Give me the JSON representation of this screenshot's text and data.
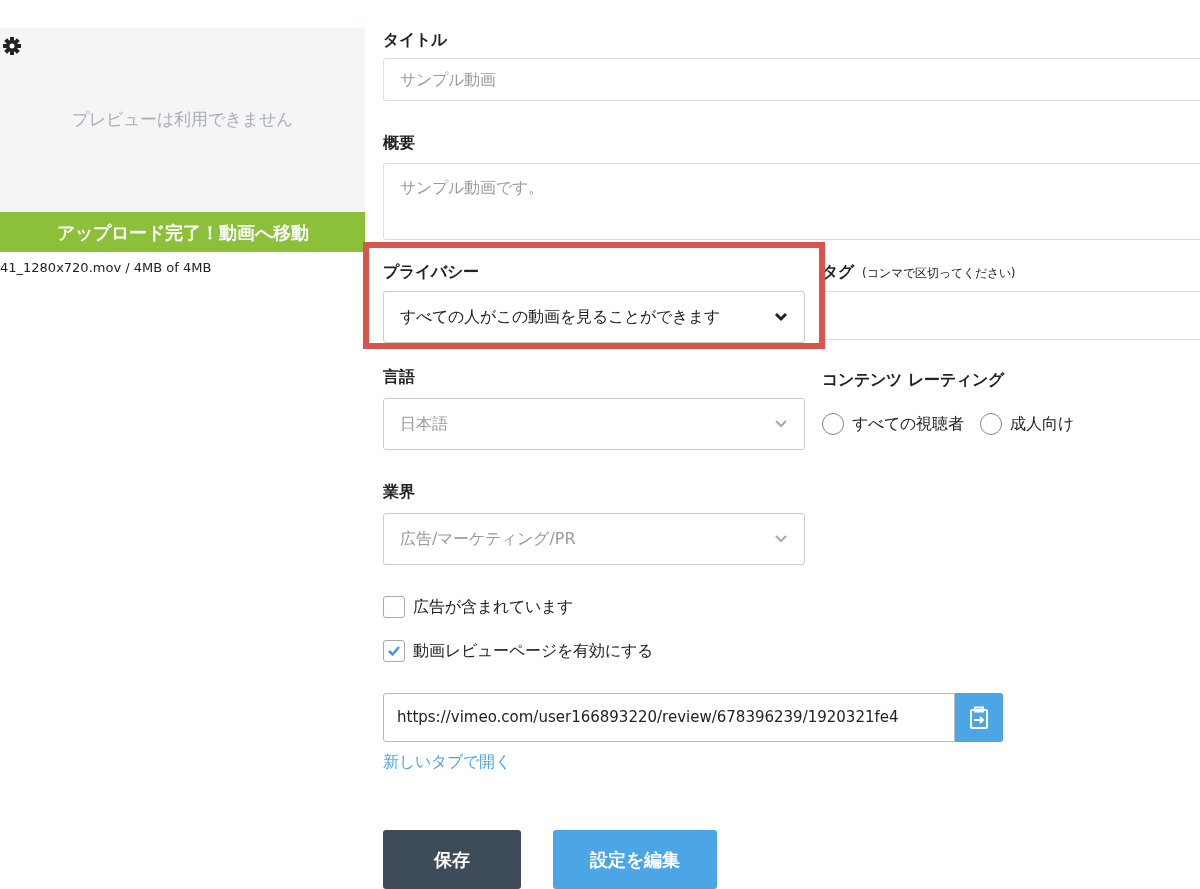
{
  "preview": {
    "message": "プレビューは利用できません",
    "banner": "アップロード完了！動画へ移動",
    "file_info": "41_1280x720.mov / 4MB of 4MB"
  },
  "title_field": {
    "label": "タイトル",
    "placeholder": "サンプル動画"
  },
  "description_field": {
    "label": "概要",
    "placeholder": "サンプル動画です。"
  },
  "privacy": {
    "label": "プライバシー",
    "value": "すべての人がこの動画を見ることができます",
    "disabled": false,
    "highlighted": true
  },
  "tags": {
    "label": "タグ",
    "hint": "(コンマで区切ってください)"
  },
  "language": {
    "label": "言語",
    "value": "日本語",
    "disabled": true
  },
  "content_rating": {
    "label": "コンテンツ レーティング",
    "options": [
      {
        "label": "すべての視聴者",
        "selected": false
      },
      {
        "label": "成人向け",
        "selected": false
      }
    ]
  },
  "industry": {
    "label": "業界",
    "value": "広告/マーケティング/PR",
    "disabled": true
  },
  "checkboxes": [
    {
      "label": "広告が含まれています",
      "checked": false
    },
    {
      "label": "動画レビューページを有効にする",
      "checked": true
    }
  ],
  "review_url": {
    "value": "https://vimeo.com/user166893220/review/678396239/1920321fe4",
    "open_link": "新しいタブで開く"
  },
  "buttons": [
    {
      "label": "保存",
      "kind": "dark"
    },
    {
      "label": "設定を編集",
      "kind": "primary"
    }
  ]
}
